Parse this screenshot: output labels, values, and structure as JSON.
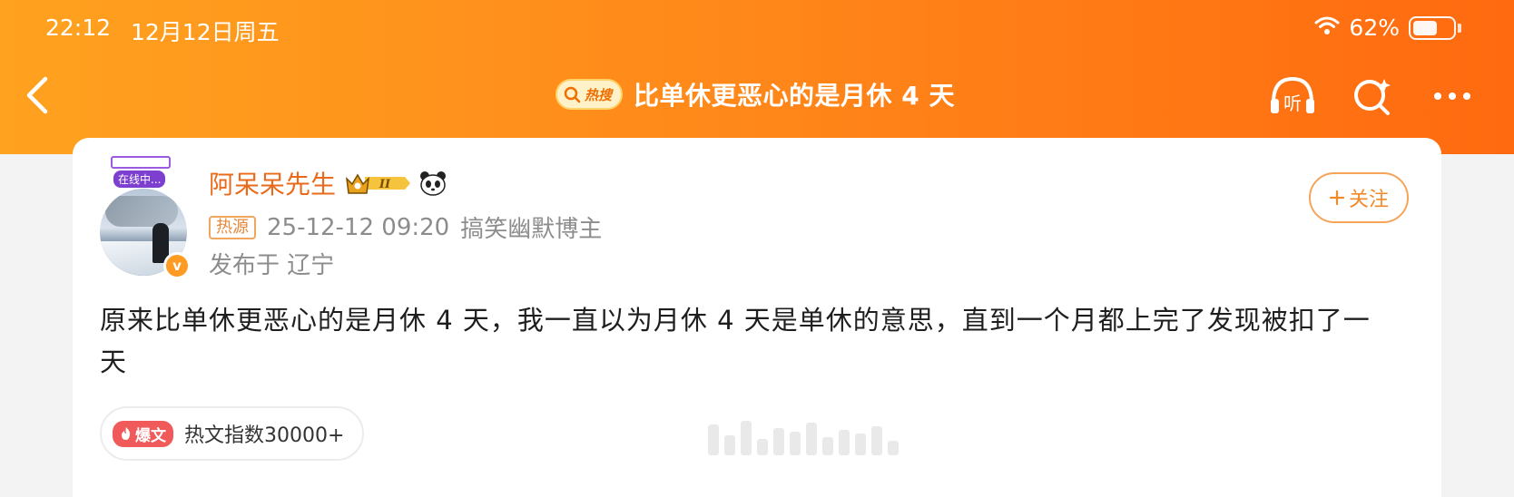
{
  "status_bar": {
    "time": "22:12",
    "date": "12月12日周五",
    "battery": "62%",
    "battery_level": 0.62
  },
  "nav": {
    "hot_label": "热搜",
    "title": "比单休更恶心的是月休 4 天",
    "listen_icon_label": "听"
  },
  "post": {
    "online_label": "在线中...",
    "username": "阿呆呆先生",
    "vip_level": "II",
    "source_tag": "热源",
    "timestamp": "25-12-12 09:20",
    "author_title": "搞笑幽默博主",
    "location": "发布于 辽宁",
    "follow_label": "关注",
    "verified_mark": "v",
    "content": "原来比单休更恶心的是月休 4 天，我一直以为月休 4 天是单休的意思，直到一个月都上完了发现被扣了一天",
    "explode_tag": "爆文",
    "hot_index": "热文指数30000+"
  },
  "colors": {
    "brand_orange": "#ff7d16",
    "username": "#e86a1a",
    "follow_border": "#f5a45a",
    "explode_red": "#f05a5a"
  }
}
